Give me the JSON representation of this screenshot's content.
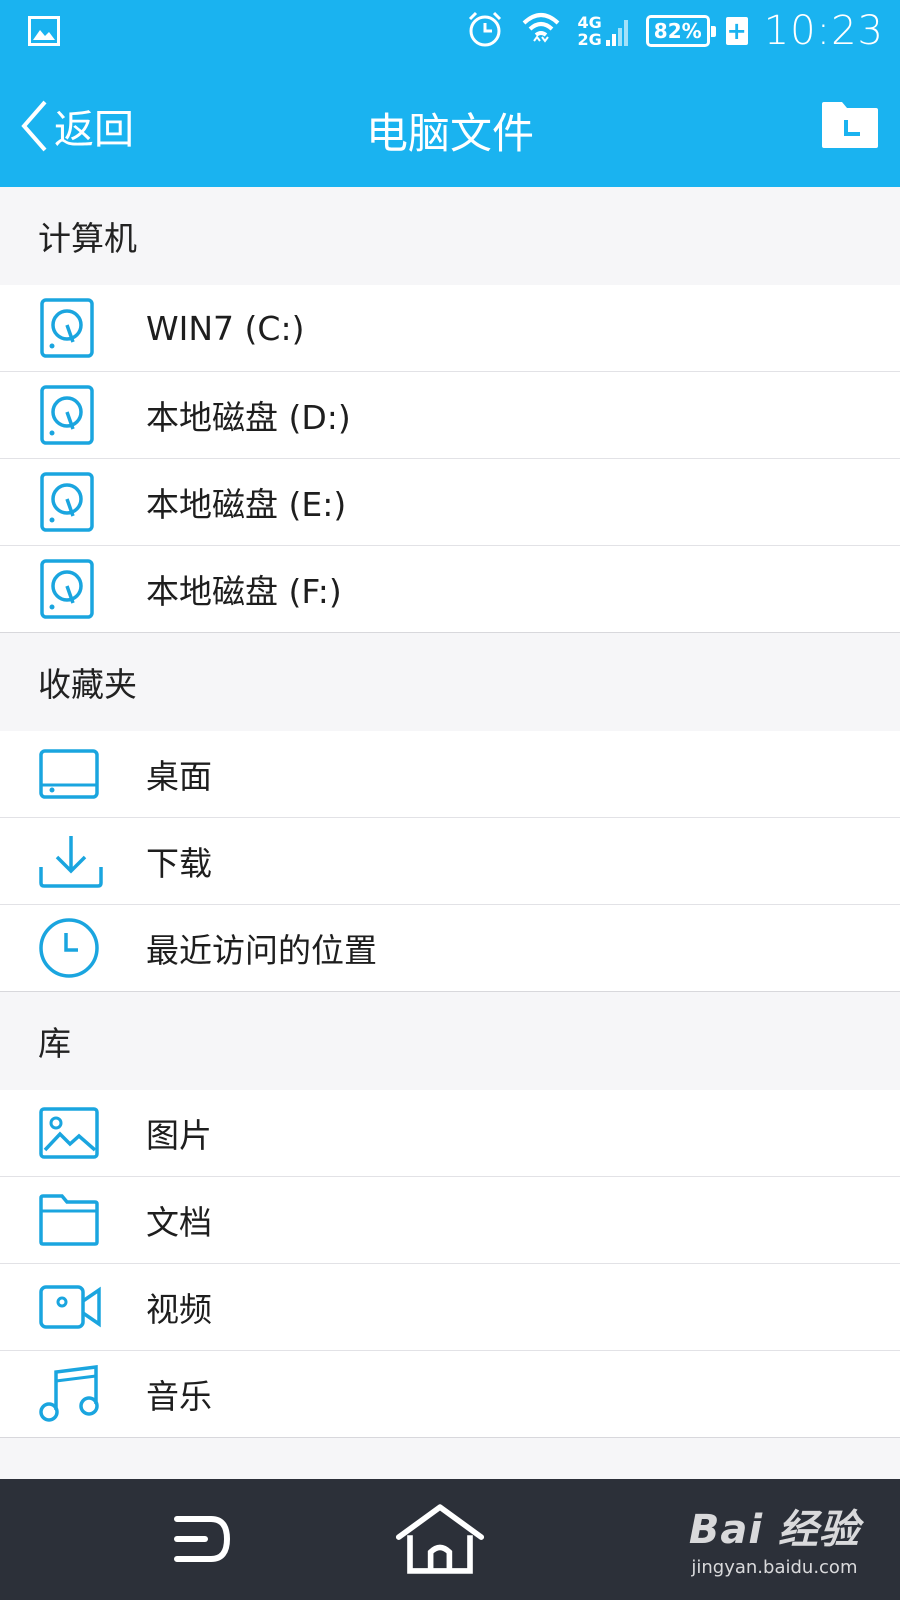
{
  "status": {
    "time": "10:23",
    "battery": "82%",
    "charging": "+",
    "net_top": "4G",
    "net_bottom": "2G"
  },
  "header": {
    "back_label": "返回",
    "title": "电脑文件"
  },
  "sections": {
    "computer": {
      "title": "计算机",
      "items": [
        {
          "label": "WIN7 (C:)",
          "icon": "hard-drive-icon"
        },
        {
          "label": "本地磁盘 (D:)",
          "icon": "hard-drive-icon"
        },
        {
          "label": "本地磁盘 (E:)",
          "icon": "hard-drive-icon"
        },
        {
          "label": "本地磁盘 (F:)",
          "icon": "hard-drive-icon"
        }
      ]
    },
    "favorites": {
      "title": "收藏夹",
      "items": [
        {
          "label": "桌面",
          "icon": "desktop-icon"
        },
        {
          "label": "下载",
          "icon": "download-icon"
        },
        {
          "label": "最近访问的位置",
          "icon": "clock-icon"
        }
      ]
    },
    "library": {
      "title": "库",
      "items": [
        {
          "label": "图片",
          "icon": "image-icon"
        },
        {
          "label": "文档",
          "icon": "folder-icon"
        },
        {
          "label": "视频",
          "icon": "video-icon"
        },
        {
          "label": "音乐",
          "icon": "music-icon"
        }
      ]
    }
  },
  "watermark": {
    "logo": "Bai 经验",
    "url": "jingyan.baidu.com"
  },
  "colors": {
    "accent": "#1ab3f0",
    "nav_bg": "#2c3039"
  }
}
